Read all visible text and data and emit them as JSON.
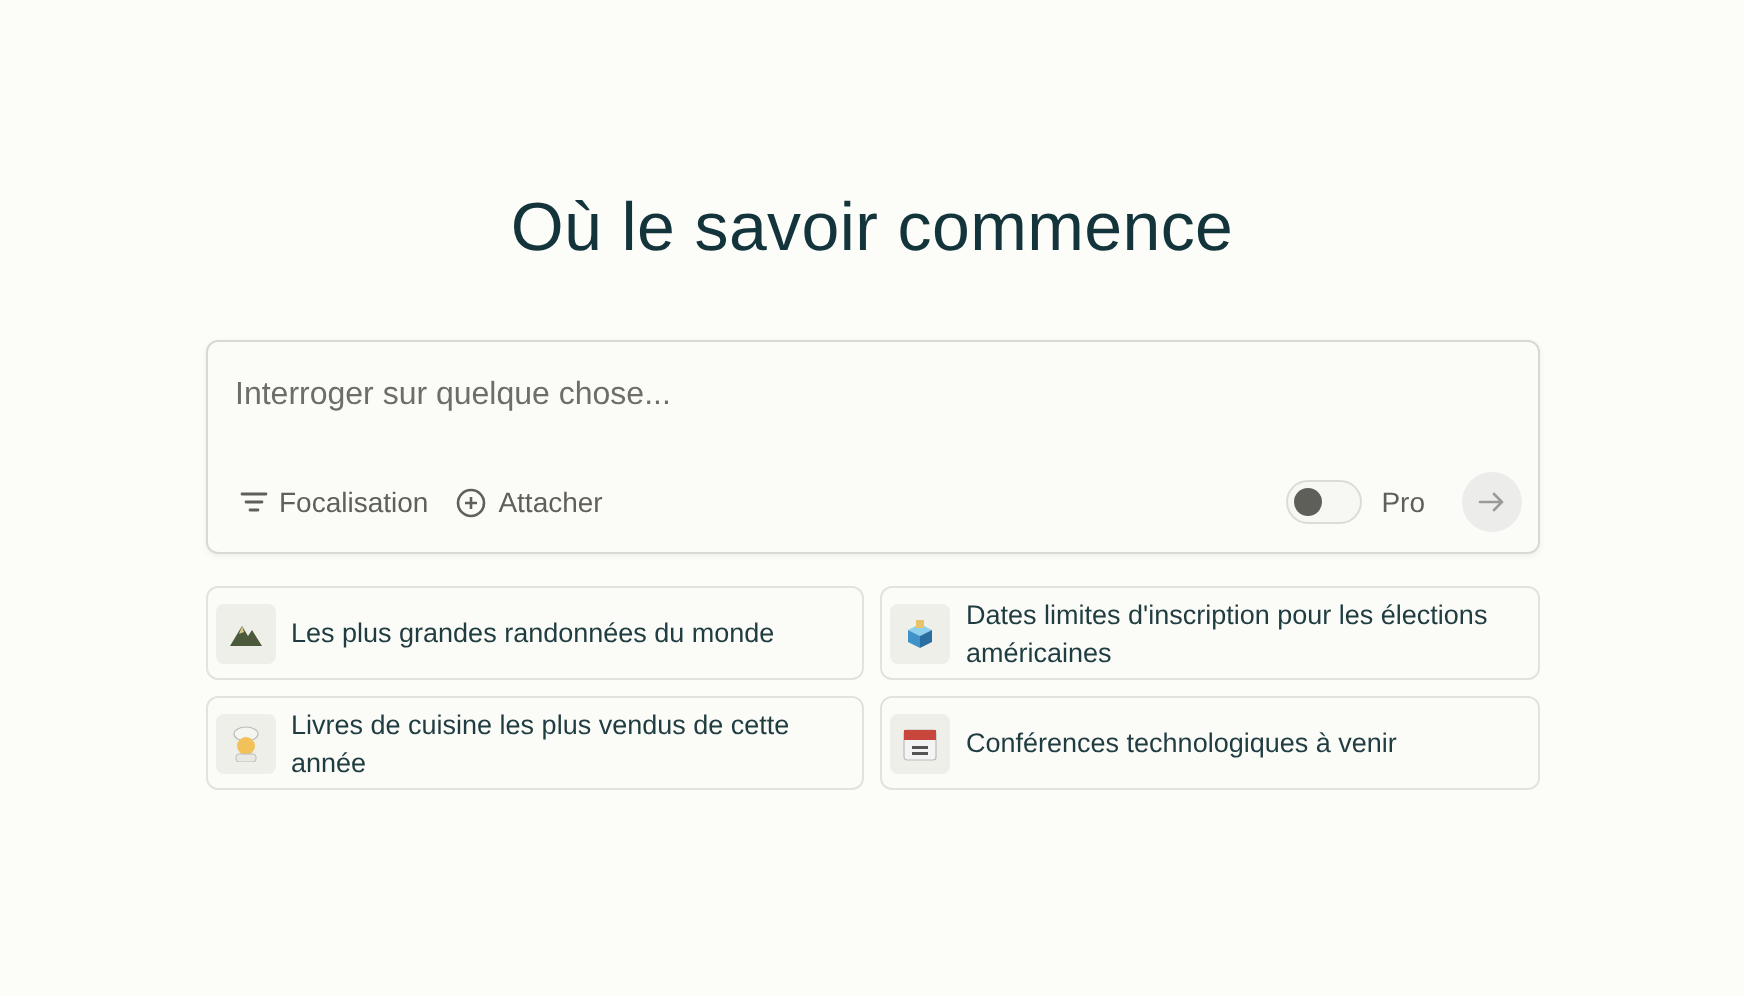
{
  "title": "Où le savoir commence",
  "search": {
    "placeholder": "Interroger sur quelque chose...",
    "focus_button": "Focalisation",
    "attach_button": "Attacher",
    "pro_toggle": {
      "label": "Pro",
      "on": false
    }
  },
  "suggestions": [
    {
      "kind": "mountain",
      "text": "Les plus grandes randonnées du monde"
    },
    {
      "kind": "ballot",
      "text": "Dates limites d'inscription pour les élections américaines"
    },
    {
      "kind": "chef",
      "text": "Livres de cuisine les plus vendus de cette année"
    },
    {
      "kind": "calendar",
      "text": "Conférences technologiques à venir"
    }
  ]
}
